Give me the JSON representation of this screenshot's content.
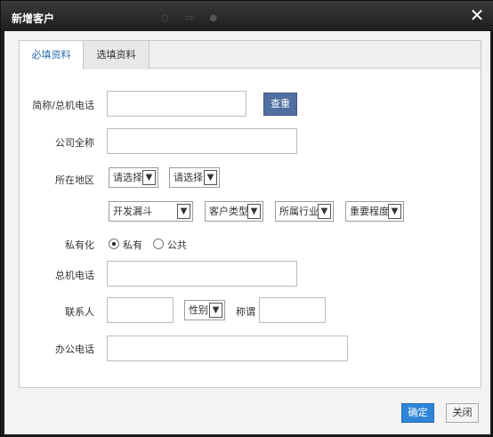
{
  "dialog": {
    "title": "新增客户",
    "close_glyph": "✕"
  },
  "tabs": [
    {
      "label": "必填资料"
    },
    {
      "label": "选填资料"
    }
  ],
  "form": {
    "short_name_label": "简称/总机电话",
    "short_name_value": "",
    "query_button": "查重",
    "company_full_label": "公司全称",
    "company_full_value": "",
    "region_label": "所在地区",
    "province_select": "请选择",
    "city_select": "请选择",
    "funnel_select": "开发漏斗",
    "customer_type_select": "客户类型",
    "industry_select": "所属行业",
    "importance_select": "重要程度",
    "privacy_label": "私有化",
    "privacy_options": [
      {
        "label": "私有",
        "selected": true
      },
      {
        "label": "公共",
        "selected": false
      }
    ],
    "main_phone_label": "总机电话",
    "main_phone_value": "",
    "contact_label": "联系人",
    "contact_value": "",
    "gender_select": "性别",
    "title_label": "称谓",
    "title_value": "",
    "office_phone_label": "办公电话",
    "office_phone_value": ""
  },
  "footer": {
    "ok_label": "确定",
    "close_label": "关闭"
  },
  "icons": {
    "select_arrow": "▼"
  },
  "colors": {
    "titlebar": "#2a2a2a",
    "query_button": "#4f6f9e",
    "ok_button": "#2f86d8",
    "active_tab_text": "#2b6cb0"
  }
}
